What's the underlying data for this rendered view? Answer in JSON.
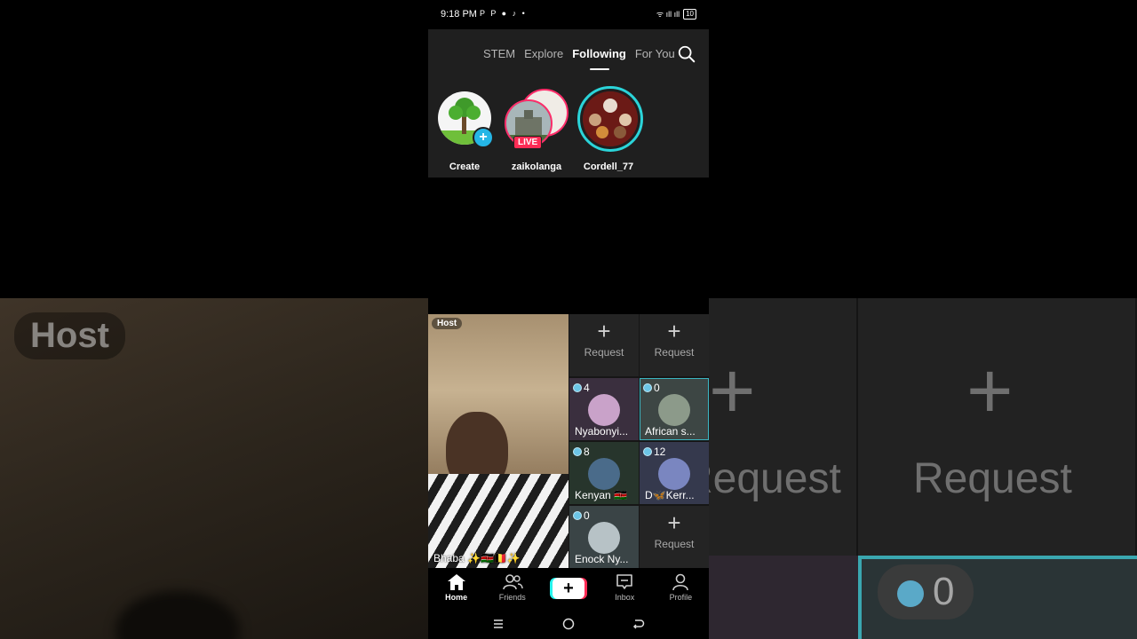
{
  "status_bar": {
    "time": "9:18 PM",
    "app_icons": "P P ● ♪ •",
    "signal_text": "ᯤ ıll ıll",
    "battery": "10"
  },
  "top_tabs": [
    {
      "label": "STEM"
    },
    {
      "label": "Explore"
    },
    {
      "label": "Following"
    },
    {
      "label": "For You"
    }
  ],
  "stories": {
    "create": "Create",
    "live_user": "zaikolanga",
    "live_badge": "LIVE",
    "other_user": "Cordell_77"
  },
  "live_grid": {
    "host_label": "Host",
    "host_name": "Bhaba ✨🇰🇪🇧🇪✨",
    "request_label": "Request",
    "guests": [
      {
        "count": "4",
        "name": "Nyabonyi..."
      },
      {
        "count": "0",
        "name": "African s..."
      },
      {
        "count": "8",
        "name": "Kenyan 🇰🇪"
      },
      {
        "count": "12",
        "name": "D🦋Kerr..."
      },
      {
        "count": "0",
        "name": "Enock Ny..."
      }
    ]
  },
  "bottom_nav": {
    "home": "Home",
    "friends": "Friends",
    "create": "+",
    "inbox": "Inbox",
    "profile": "Profile"
  },
  "background": {
    "host": "Host",
    "request": "Request",
    "plus": "+",
    "count": "0"
  },
  "colors": {
    "accent_cyan": "#25b6e6",
    "live_pink": "#fe2c55",
    "selected_tile": "#3bb6c2"
  }
}
